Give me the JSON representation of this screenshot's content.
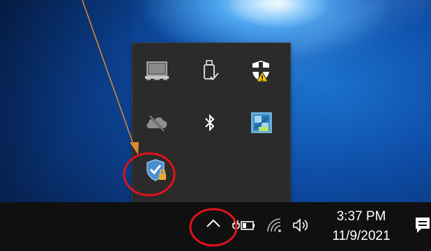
{
  "tray": {
    "icons": [
      {
        "name": "laptop-icon"
      },
      {
        "name": "usb-drive-icon"
      },
      {
        "name": "defender-warning-icon"
      },
      {
        "name": "onedrive-offline-icon"
      },
      {
        "name": "bluetooth-icon"
      },
      {
        "name": "intel-graphics-icon"
      },
      {
        "name": "security-shield-lock-icon"
      }
    ]
  },
  "taskbar": {
    "time": "3:37 PM",
    "date": "11/9/2021"
  },
  "colors": {
    "annotation_red": "#e0121c",
    "annotation_arrow": "#e08a2c",
    "taskbar": "#101010",
    "flyout": "#2b2b2b"
  }
}
